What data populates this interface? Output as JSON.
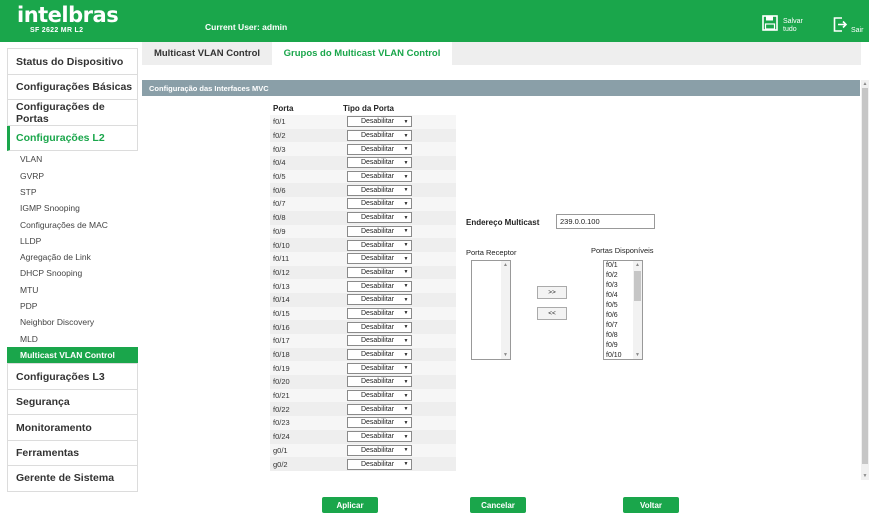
{
  "brand": {
    "logo": "intelbras",
    "model": "SF 2622 MR L2"
  },
  "header": {
    "current_user": "Current User: admin",
    "save_label_1": "Salvar",
    "save_label_2": "tudo",
    "exit_label": "Sair",
    "save_icon": "floppy-disk-icon",
    "exit_icon": "logout-icon"
  },
  "sidebar": {
    "top_items": [
      "Status do Dispositivo",
      "Configurações Básicas",
      "Configurações de Portas",
      "Configurações L2"
    ],
    "sub_items": [
      "VLAN",
      "GVRP",
      "STP",
      "IGMP Snooping",
      "Configurações de MAC",
      "LLDP",
      "Agregação de Link",
      "DHCP Snooping",
      "MTU",
      "PDP",
      "Neighbor Discovery",
      "MLD",
      "Multicast VLAN Control"
    ],
    "bottom_items": [
      "Configurações L3",
      "Segurança",
      "Monitoramento",
      "Ferramentas",
      "Gerente de Sistema"
    ]
  },
  "tabs": [
    "Multicast VLAN Control",
    "Grupos do Multicast VLAN Control"
  ],
  "section_title": "Configuração das Interfaces MVC",
  "port_table": {
    "col_port": "Porta",
    "col_type": "Tipo da Porta",
    "rows": [
      {
        "port": "f0/1",
        "type": "Desabilitar"
      },
      {
        "port": "f0/2",
        "type": "Desabilitar"
      },
      {
        "port": "f0/3",
        "type": "Desabilitar"
      },
      {
        "port": "f0/4",
        "type": "Desabilitar"
      },
      {
        "port": "f0/5",
        "type": "Desabilitar"
      },
      {
        "port": "f0/6",
        "type": "Desabilitar"
      },
      {
        "port": "f0/7",
        "type": "Desabilitar"
      },
      {
        "port": "f0/8",
        "type": "Desabilitar"
      },
      {
        "port": "f0/9",
        "type": "Desabilitar"
      },
      {
        "port": "f0/10",
        "type": "Desabilitar"
      },
      {
        "port": "f0/11",
        "type": "Desabilitar"
      },
      {
        "port": "f0/12",
        "type": "Desabilitar"
      },
      {
        "port": "f0/13",
        "type": "Desabilitar"
      },
      {
        "port": "f0/14",
        "type": "Desabilitar"
      },
      {
        "port": "f0/15",
        "type": "Desabilitar"
      },
      {
        "port": "f0/16",
        "type": "Desabilitar"
      },
      {
        "port": "f0/17",
        "type": "Desabilitar"
      },
      {
        "port": "f0/18",
        "type": "Desabilitar"
      },
      {
        "port": "f0/19",
        "type": "Desabilitar"
      },
      {
        "port": "f0/20",
        "type": "Desabilitar"
      },
      {
        "port": "f0/21",
        "type": "Desabilitar"
      },
      {
        "port": "f0/22",
        "type": "Desabilitar"
      },
      {
        "port": "f0/23",
        "type": "Desabilitar"
      },
      {
        "port": "f0/24",
        "type": "Desabilitar"
      },
      {
        "port": "g0/1",
        "type": "Desabilitar"
      },
      {
        "port": "g0/2",
        "type": "Desabilitar"
      }
    ]
  },
  "multicast": {
    "label": "Endereço Multicast",
    "value": "239.0.0.100"
  },
  "receiver": {
    "label": "Porta Receptor"
  },
  "available": {
    "label": "Portas Disponíveis",
    "items": [
      "f0/1",
      "f0/2",
      "f0/3",
      "f0/4",
      "f0/5",
      "f0/6",
      "f0/7",
      "f0/8",
      "f0/9",
      "f0/10"
    ]
  },
  "move_buttons": {
    "add": ">>",
    "remove": "<<"
  },
  "actions": {
    "apply": "Aplicar",
    "cancel": "Cancelar",
    "back": "Voltar"
  },
  "colors": {
    "brand_green": "#1aa64b",
    "section_bar": "#8a9fa8"
  }
}
